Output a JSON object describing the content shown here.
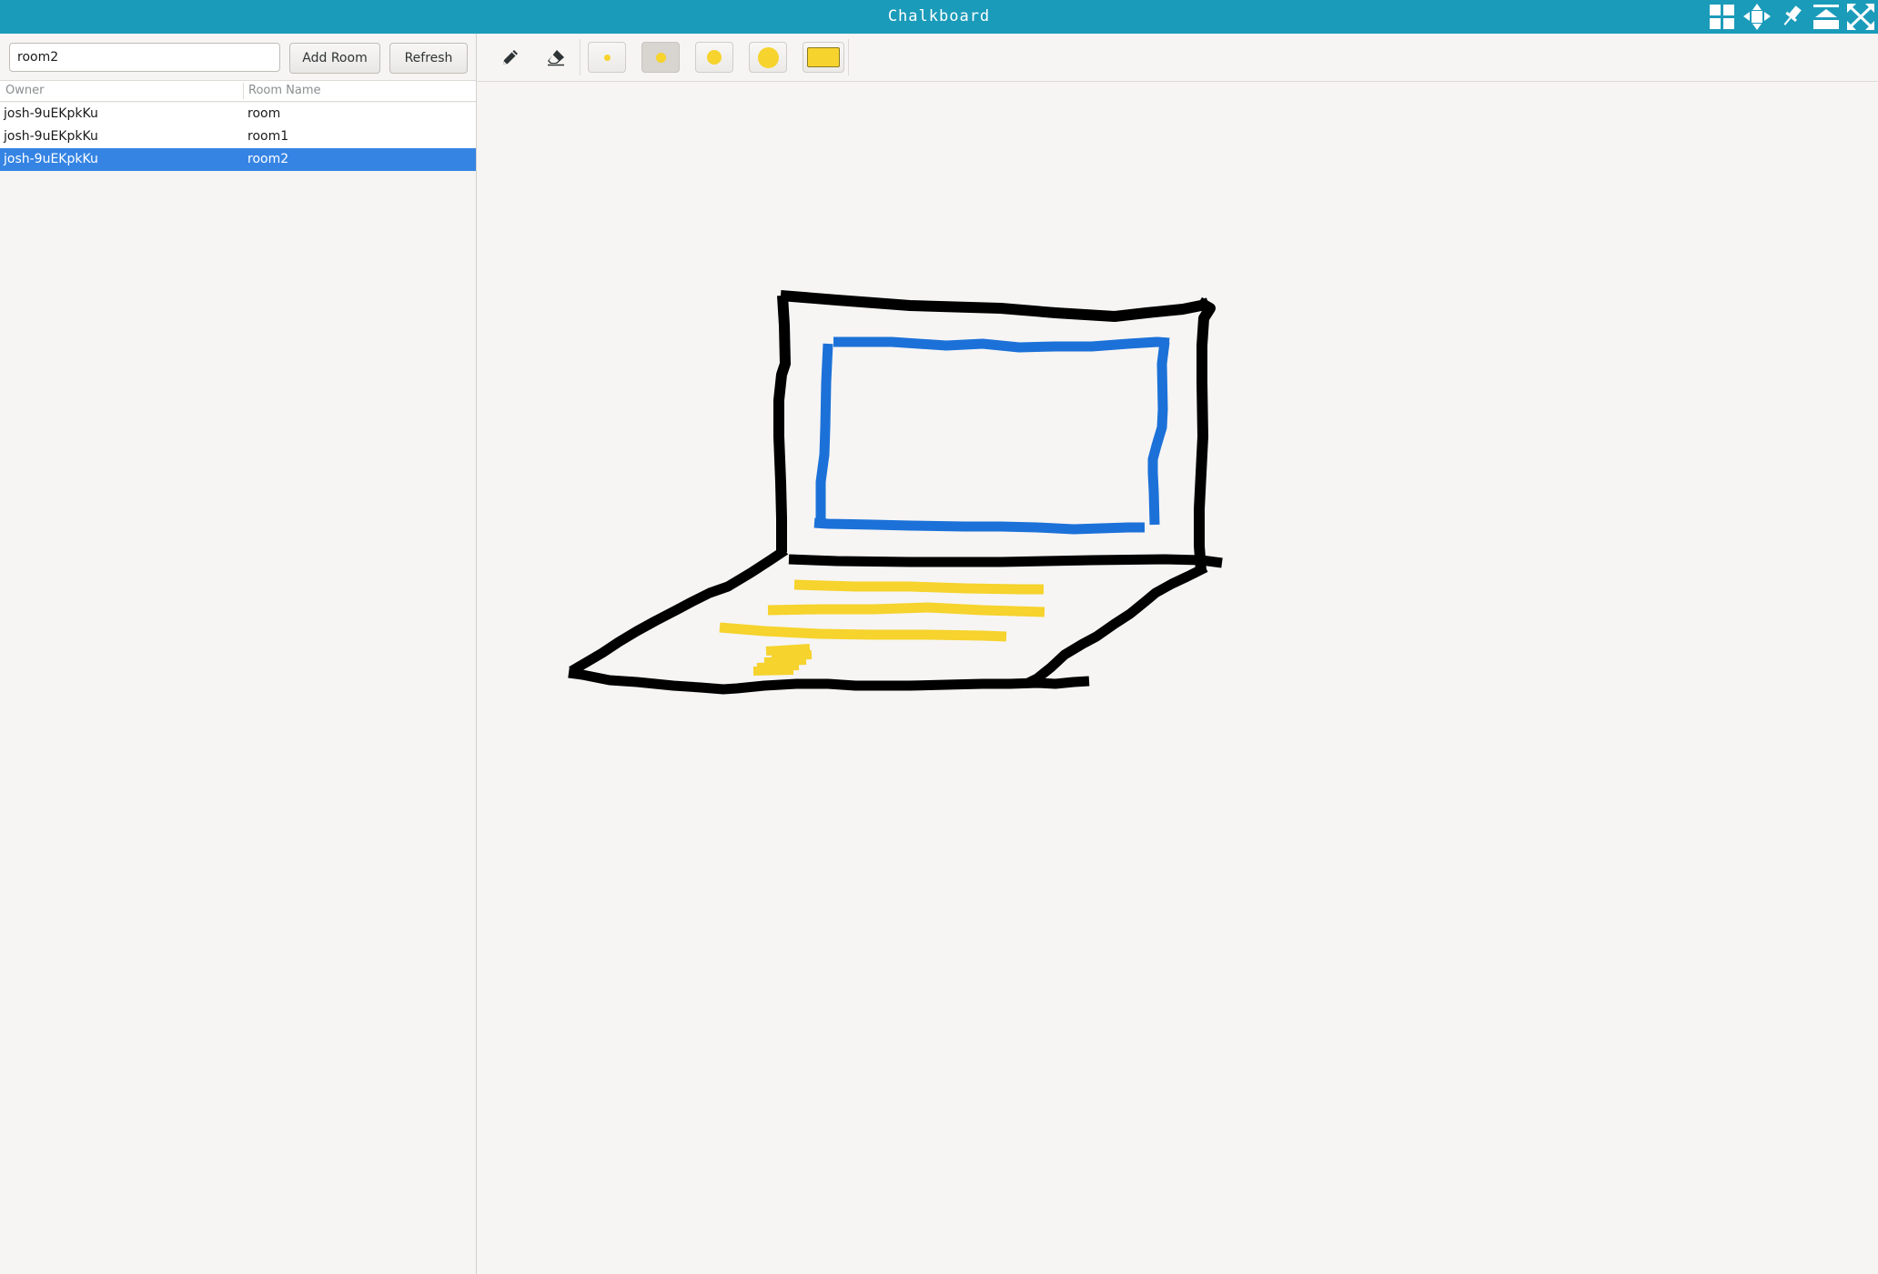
{
  "window": {
    "title": "Chalkboard",
    "controls": [
      "tile-icon",
      "move-icon",
      "pin-icon",
      "minimize-icon",
      "maximize-icon"
    ]
  },
  "sidebar": {
    "room_input": {
      "value": "room2",
      "placeholder": ""
    },
    "add_room_label": "Add Room",
    "refresh_label": "Refresh",
    "columns": {
      "owner": "Owner",
      "room_name": "Room Name"
    },
    "rows": [
      {
        "owner": "josh-9uEKpkKu",
        "room_name": "room",
        "selected": false
      },
      {
        "owner": "josh-9uEKpkKu",
        "room_name": "room1",
        "selected": false
      },
      {
        "owner": "josh-9uEKpkKu",
        "room_name": "room2",
        "selected": true
      }
    ]
  },
  "toolbar": {
    "tools": [
      "pencil-icon",
      "eraser-icon"
    ],
    "active_tool": "pencil",
    "brush_sizes": [
      "small",
      "medium",
      "large",
      "xlarge"
    ],
    "selected_size": "medium",
    "brush_color": "#f6d32d"
  },
  "colors": {
    "titlebar": "#1b9bba",
    "selection": "#3584e4",
    "stroke_black": "#000000",
    "stroke_blue": "#1c71d8",
    "stroke_yellow": "#f6d32d"
  }
}
